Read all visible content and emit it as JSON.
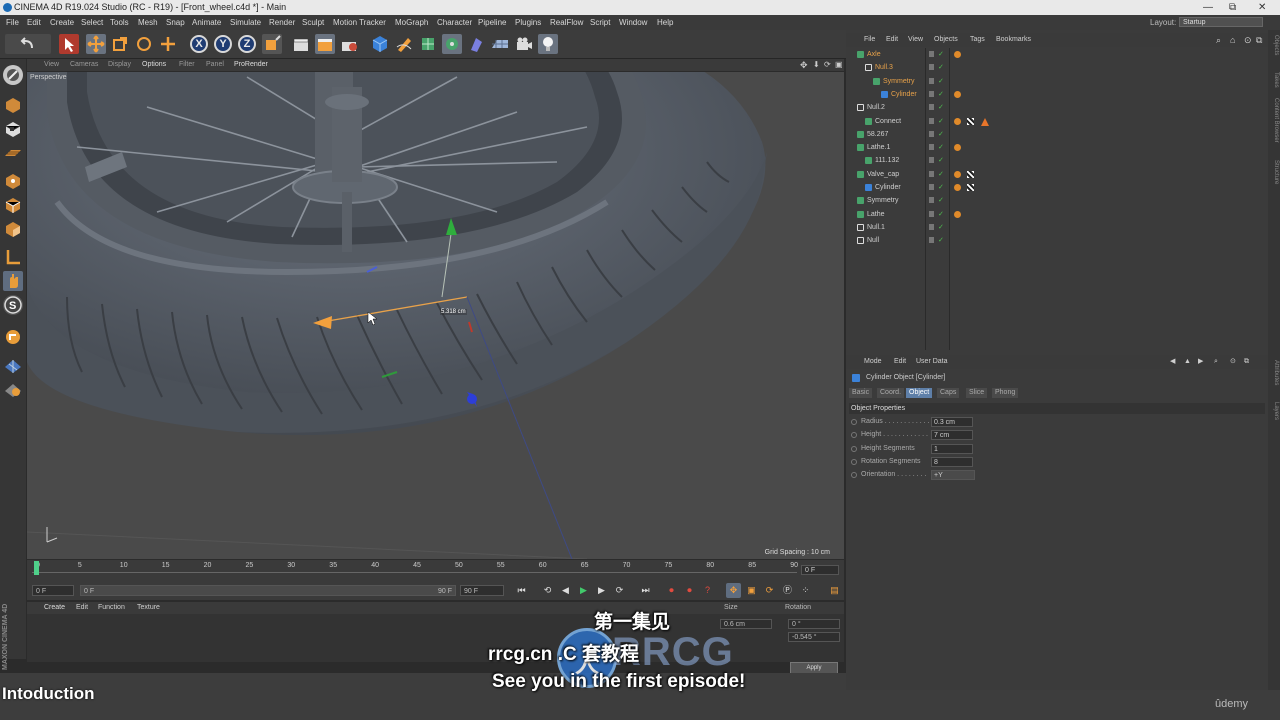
{
  "titlebar": {
    "title": "CINEMA 4D R19.024 Studio (RC - R19) - [Front_wheel.c4d *] - Main",
    "min": "—",
    "restore": "⧉",
    "close": "✕"
  },
  "menubar": {
    "items": [
      "File",
      "Edit",
      "Create",
      "Select",
      "Tools",
      "Mesh",
      "Snap",
      "Animate",
      "Simulate",
      "Render",
      "Sculpt",
      "Motion Tracker",
      "MoGraph",
      "Character",
      "Pipeline",
      "Plugins",
      "RealFlow",
      "Script",
      "Window",
      "Help"
    ],
    "layout_label": "Layout:",
    "layout_value": "Startup"
  },
  "toolbar": {
    "x": "X",
    "y": "Y",
    "z": "Z"
  },
  "viewport": {
    "menu": [
      "View",
      "Cameras",
      "Display",
      "Options",
      "Filter",
      "Panel",
      "ProRender"
    ],
    "label": "Perspective",
    "grid_spacing": "Grid Spacing : 10 cm",
    "measure": "5.318 cm"
  },
  "timeline": {
    "ticks": [
      "0",
      "5",
      "10",
      "15",
      "20",
      "25",
      "30",
      "35",
      "40",
      "45",
      "50",
      "55",
      "60",
      "65",
      "70",
      "75",
      "80",
      "85",
      "90"
    ],
    "current_frame": "0 F",
    "start": "0 F",
    "range_start": "0 F",
    "range_end": "90 F",
    "end": "90 F"
  },
  "material_manager": {
    "menu": [
      "Create",
      "Edit",
      "Function",
      "Texture"
    ]
  },
  "coordinates": {
    "size_label": "Size",
    "rotation_label": "Rotation",
    "size_x": "0.6 cm",
    "rot_h": "0 °",
    "rot_p": "-0.545 °",
    "apply": "Apply"
  },
  "object_manager": {
    "menu": [
      "File",
      "Edit",
      "View",
      "Objects",
      "Tags",
      "Bookmarks"
    ],
    "objects": [
      {
        "name": "Axle",
        "indent": 0,
        "color": "#e8a24a",
        "icon": "axle-icon"
      },
      {
        "name": "Null.3",
        "indent": 1,
        "color": "#e8a24a",
        "icon": "null-icon"
      },
      {
        "name": "Symmetry",
        "indent": 2,
        "color": "#e8a24a",
        "icon": "symmetry-icon"
      },
      {
        "name": "Cylinder",
        "indent": 3,
        "color": "#e8a24a",
        "icon": "cylinder-icon"
      },
      {
        "name": "Null.2",
        "indent": 0,
        "color": "#cfcfcf",
        "icon": "null-icon"
      },
      {
        "name": "Connect",
        "indent": 1,
        "color": "#cfcfcf",
        "icon": "connect-icon"
      },
      {
        "name": "58.267",
        "indent": 0,
        "color": "#cfcfcf",
        "icon": "spline-icon"
      },
      {
        "name": "Lathe.1",
        "indent": 0,
        "color": "#cfcfcf",
        "icon": "lathe-icon"
      },
      {
        "name": "111.132",
        "indent": 1,
        "color": "#cfcfcf",
        "icon": "spline-icon"
      },
      {
        "name": "Valve_cap",
        "indent": 0,
        "color": "#cfcfcf",
        "icon": "connect-icon"
      },
      {
        "name": "Cylinder",
        "indent": 1,
        "color": "#cfcfcf",
        "icon": "cylinder-icon"
      },
      {
        "name": "Symmetry",
        "indent": 0,
        "color": "#cfcfcf",
        "icon": "symmetry-icon"
      },
      {
        "name": "Lathe",
        "indent": 0,
        "color": "#cfcfcf",
        "icon": "lathe-icon"
      },
      {
        "name": "Null.1",
        "indent": 0,
        "color": "#cfcfcf",
        "icon": "null-icon"
      },
      {
        "name": "Null",
        "indent": 0,
        "color": "#cfcfcf",
        "icon": "null-icon"
      }
    ]
  },
  "attributes": {
    "menu": [
      "Mode",
      "Edit",
      "User Data"
    ],
    "title": "Cylinder Object [Cylinder]",
    "tabs": [
      "Basic",
      "Coord.",
      "Object",
      "Caps",
      "Slice",
      "Phong"
    ],
    "active_tab": "Object",
    "section": "Object Properties",
    "props": [
      {
        "label": "Radius . . . . . . . . . . . .",
        "value": "0.3 cm"
      },
      {
        "label": "Height . . . . . . . . . . . .",
        "value": "7 cm"
      },
      {
        "label": "Height Segments",
        "value": "1"
      },
      {
        "label": "Rotation Segments",
        "value": "8"
      },
      {
        "label": "Orientation . . . . . . . .",
        "value": "+Y"
      }
    ]
  },
  "right_strip": [
    "Objects",
    "Takes",
    "Content Browser",
    "Structure",
    "Attributes",
    "Layers"
  ],
  "overlay": {
    "intro": "Intoduction",
    "udemy": "ûdemy",
    "sub_cn": "第一集见",
    "sub_mid": "rrcg.cn    .C    套教程",
    "sub_en": "See you in the first episode!",
    "wm_text": "RRCG",
    "wm_logo": "人"
  },
  "maxon": "MAXON CINEMA 4D",
  "colors": {
    "accent": "#5e7fa8",
    "orange": "#e8a24a",
    "bg": "#3b3b3b",
    "viewport": "#4a4a4a"
  }
}
